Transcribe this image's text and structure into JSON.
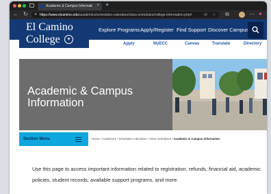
{
  "browser": {
    "tab_title": "Academic & Campus Information",
    "tab_close": "×",
    "new_tab": "+",
    "url_domain": "https://www.elcamino.edu",
    "url_path": "/academics/schedules-calendars/class-schedules/college-information.php#"
  },
  "header": {
    "logo_line1": "El Camino",
    "logo_line2": "College",
    "nav": [
      "Explore Programs",
      "Apply/Register",
      "Find Support",
      "Discover Campus"
    ],
    "util": [
      "Apply",
      "MyECC",
      "Canvas",
      "Translate",
      "Directory"
    ]
  },
  "hero": {
    "title": "Academic & Campus Information"
  },
  "section_menu": {
    "label": "Section Menu"
  },
  "breadcrumb": {
    "items": [
      "Home",
      "Academics",
      "Schedules Calendars",
      "Class Schedules"
    ],
    "current": "Academic & Campus Information",
    "sep": "/"
  },
  "intro": {
    "text": "Use this page to access important information related to registration, refunds, financial aid, academic policies, student records, available support programs, and more."
  },
  "colors": {
    "brand_navy": "#143a75",
    "accent_cyan": "#0ea7dd",
    "link_blue": "#1f5ca8"
  }
}
